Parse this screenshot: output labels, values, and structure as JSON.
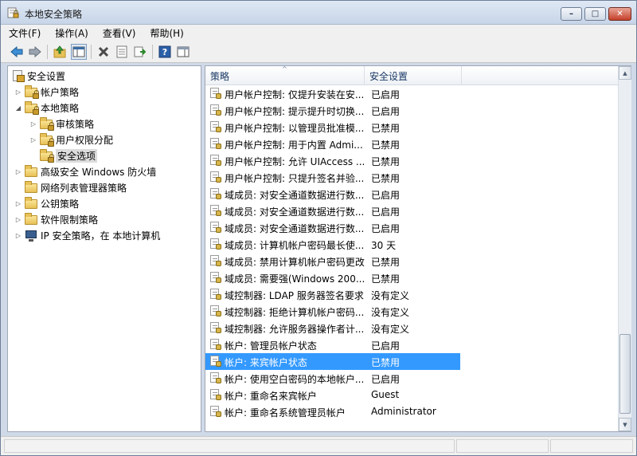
{
  "window": {
    "title": "本地安全策略",
    "controls": {
      "minimize": "–",
      "maximize": "□",
      "close": "✕"
    }
  },
  "menubar": {
    "items": [
      "文件(F)",
      "操作(A)",
      "查看(V)",
      "帮助(H)"
    ]
  },
  "toolbar": {
    "buttons": [
      {
        "name": "back-button",
        "icon": "back-arrow-icon"
      },
      {
        "name": "forward-button",
        "icon": "forward-arrow-icon"
      },
      {
        "name": "up-button",
        "icon": "up-folder-icon"
      },
      {
        "name": "show-hide-tree-button",
        "icon": "console-tree-icon"
      },
      {
        "name": "delete-button",
        "icon": "delete-x-icon"
      },
      {
        "name": "properties-button",
        "icon": "properties-icon"
      },
      {
        "name": "export-button",
        "icon": "export-list-icon"
      },
      {
        "name": "help-button",
        "icon": "help-icon"
      },
      {
        "name": "show-action-pane-button",
        "icon": "action-pane-icon"
      }
    ]
  },
  "tree": {
    "root": "安全设置",
    "items": [
      {
        "label": "帐户策略",
        "expanded": false
      },
      {
        "label": "本地策略",
        "expanded": true
      },
      {
        "label": "审核策略",
        "expanded": false
      },
      {
        "label": "用户权限分配",
        "expanded": false
      },
      {
        "label": "安全选项",
        "selected": true
      },
      {
        "label": "高级安全 Windows 防火墙",
        "expanded": false
      },
      {
        "label": "网络列表管理器策略"
      },
      {
        "label": "公钥策略",
        "expanded": false
      },
      {
        "label": "软件限制策略",
        "expanded": false
      },
      {
        "label": "IP 安全策略，在 本地计算机",
        "expanded": false
      }
    ]
  },
  "list": {
    "columns": [
      "策略",
      "安全设置"
    ],
    "rows": [
      {
        "policy": "用户帐户控制: 仅提升安装在安...",
        "setting": "已启用"
      },
      {
        "policy": "用户帐户控制: 提示提升时切换...",
        "setting": "已启用"
      },
      {
        "policy": "用户帐户控制: 以管理员批准模...",
        "setting": "已禁用"
      },
      {
        "policy": "用户帐户控制: 用于内置 Admi...",
        "setting": "已禁用"
      },
      {
        "policy": "用户帐户控制: 允许 UIAccess ...",
        "setting": "已禁用"
      },
      {
        "policy": "用户帐户控制: 只提升签名并验...",
        "setting": "已禁用"
      },
      {
        "policy": "域成员: 对安全通道数据进行数...",
        "setting": "已启用"
      },
      {
        "policy": "域成员: 对安全通道数据进行数...",
        "setting": "已启用"
      },
      {
        "policy": "域成员: 对安全通道数据进行数...",
        "setting": "已启用"
      },
      {
        "policy": "域成员: 计算机帐户密码最长使...",
        "setting": "30 天"
      },
      {
        "policy": "域成员: 禁用计算机帐户密码更改",
        "setting": "已禁用"
      },
      {
        "policy": "域成员: 需要强(Windows 200...",
        "setting": "已禁用"
      },
      {
        "policy": "域控制器: LDAP 服务器签名要求",
        "setting": "没有定义"
      },
      {
        "policy": "域控制器: 拒绝计算机帐户密码...",
        "setting": "没有定义"
      },
      {
        "policy": "域控制器: 允许服务器操作者计...",
        "setting": "没有定义"
      },
      {
        "policy": "帐户: 管理员帐户状态",
        "setting": "已启用"
      },
      {
        "policy": "帐户: 来宾帐户状态",
        "setting": "已禁用",
        "selected": true
      },
      {
        "policy": "帐户: 使用空白密码的本地帐户...",
        "setting": "已启用"
      },
      {
        "policy": "帐户: 重命名来宾帐户",
        "setting": "Guest"
      },
      {
        "policy": "帐户: 重命名系统管理员帐户",
        "setting": "Administrator"
      }
    ]
  },
  "colors": {
    "selection": "#3399ff",
    "title_bar": "#c7d5e8",
    "folder": "#e8c156"
  }
}
